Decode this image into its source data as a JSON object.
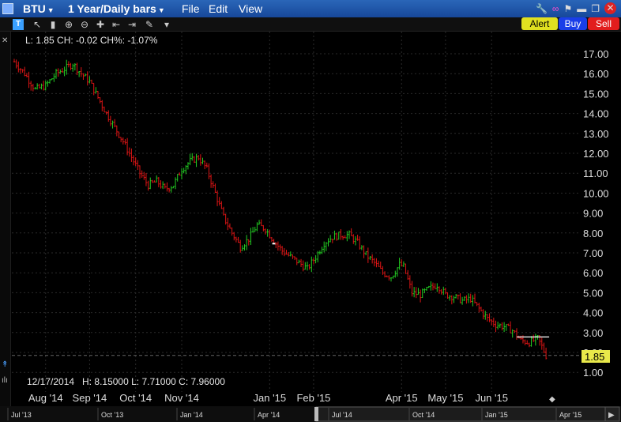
{
  "window": {
    "symbol": "BTU",
    "period": "1 Year/Daily bars",
    "menus": [
      "File",
      "Edit",
      "View"
    ]
  },
  "actions": {
    "alert": "Alert",
    "buy": "Buy",
    "sell": "Sell"
  },
  "quote_line": "L: 1.85 CH: -0.02 CH%: -1.07%",
  "hover_line": "12/17/2014   H: 8.15000 L: 7.71000 C: 7.96000",
  "last_price": "1.85",
  "colors": {
    "up": "#22cc22",
    "down": "#e01515",
    "last_tag": "#e8e84a",
    "grid": "#2a2a2a"
  },
  "nav_labels": [
    "Jul '13",
    "Oct '13",
    "Jan '14",
    "Apr '14",
    "Jul '14",
    "Oct '14",
    "Jan '15",
    "Apr '15"
  ],
  "chart_data": {
    "type": "candlestick",
    "y_ticks": [
      "17.00",
      "16.00",
      "15.00",
      "14.00",
      "13.00",
      "12.00",
      "11.00",
      "10.00",
      "9.00",
      "8.00",
      "7.00",
      "6.00",
      "5.00",
      "4.00",
      "3.00",
      "2.00",
      "1.00"
    ],
    "ylim": [
      0.55,
      17.55
    ],
    "x_ticks": [
      "Aug '14",
      "Sep '14",
      "Oct '14",
      "Nov '14",
      "Jan '15",
      "Feb '15",
      "Apr '15",
      "May '15",
      "Jun '15"
    ],
    "x_tick_index": [
      15,
      36,
      58,
      80,
      122,
      143,
      185,
      206,
      228
    ],
    "close_path": [
      [
        0,
        16.6
      ],
      [
        5,
        16.0
      ],
      [
        10,
        15.2
      ],
      [
        15,
        15.4
      ],
      [
        20,
        16.0
      ],
      [
        25,
        16.3
      ],
      [
        28,
        16.5
      ],
      [
        32,
        16.0
      ],
      [
        36,
        15.6
      ],
      [
        40,
        14.8
      ],
      [
        44,
        14.0
      ],
      [
        48,
        13.3
      ],
      [
        52,
        12.6
      ],
      [
        56,
        11.8
      ],
      [
        60,
        11.0
      ],
      [
        64,
        10.4
      ],
      [
        68,
        10.6
      ],
      [
        72,
        10.2
      ],
      [
        76,
        10.4
      ],
      [
        80,
        11.2
      ],
      [
        84,
        11.6
      ],
      [
        88,
        11.8
      ],
      [
        92,
        11.2
      ],
      [
        96,
        10.0
      ],
      [
        100,
        8.8
      ],
      [
        104,
        8.0
      ],
      [
        108,
        7.3
      ],
      [
        112,
        7.7
      ],
      [
        116,
        8.4
      ],
      [
        120,
        8.2
      ],
      [
        124,
        7.6
      ],
      [
        128,
        7.1
      ],
      [
        132,
        6.8
      ],
      [
        136,
        6.5
      ],
      [
        140,
        6.2
      ],
      [
        144,
        6.8
      ],
      [
        148,
        7.5
      ],
      [
        152,
        7.8
      ],
      [
        156,
        7.9
      ],
      [
        160,
        7.9
      ],
      [
        164,
        7.5
      ],
      [
        168,
        6.9
      ],
      [
        172,
        6.5
      ],
      [
        176,
        6.0
      ],
      [
        180,
        5.8
      ],
      [
        184,
        6.4
      ],
      [
        186,
        6.3
      ],
      [
        190,
        5.0
      ],
      [
        194,
        4.9
      ],
      [
        198,
        5.2
      ],
      [
        202,
        5.4
      ],
      [
        206,
        4.9
      ],
      [
        210,
        4.8
      ],
      [
        214,
        4.6
      ],
      [
        218,
        4.7
      ],
      [
        222,
        4.2
      ],
      [
        226,
        3.7
      ],
      [
        230,
        3.4
      ],
      [
        234,
        3.3
      ],
      [
        238,
        3.1
      ],
      [
        242,
        2.6
      ],
      [
        246,
        2.5
      ],
      [
        250,
        2.7
      ],
      [
        252,
        2.3
      ],
      [
        254,
        1.85
      ]
    ],
    "highlight_bar_index": 124,
    "reference_line": {
      "value": 2.78,
      "from_index": 240,
      "to_index": 254
    }
  }
}
